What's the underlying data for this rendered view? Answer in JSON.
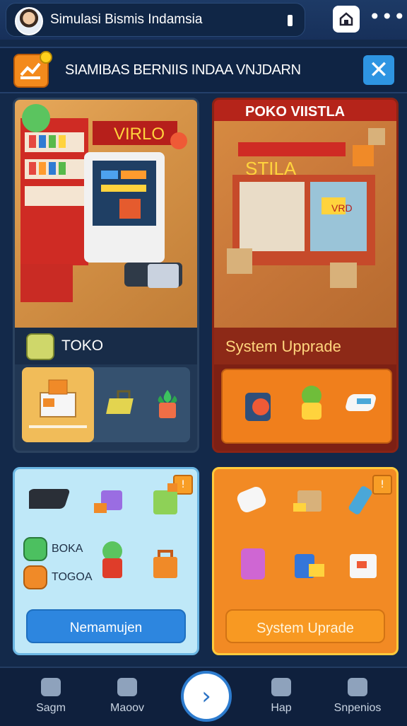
{
  "app": {
    "title": "Simulasi Bismis Indamsia",
    "more_icon": "more-icon",
    "home_icon": "home-icon"
  },
  "header": {
    "title": "SIAMIBAS BERNIIS INDAA VNJDARN",
    "close_icon": "close-icon"
  },
  "cards": {
    "top_left": {
      "section_title": "TOKO"
    },
    "top_right": {
      "banner_title": "POKO VIISTLA",
      "section_title": "System Upprade"
    },
    "bottom_left": {
      "labels": [
        "BOKA",
        "TOGOA"
      ],
      "button_label": "Nemamujen"
    },
    "bottom_right": {
      "button_label": "System Uprade"
    }
  },
  "nav": {
    "items": [
      {
        "label": "Sagm"
      },
      {
        "label": "Maoov"
      },
      {
        "label": "Hap"
      },
      {
        "label": "Snpenios"
      }
    ],
    "center_icon": "chevron-right-icon"
  },
  "colors": {
    "accent_blue": "#2d86df",
    "accent_orange": "#f28a24",
    "dark_bg": "#13294a"
  }
}
